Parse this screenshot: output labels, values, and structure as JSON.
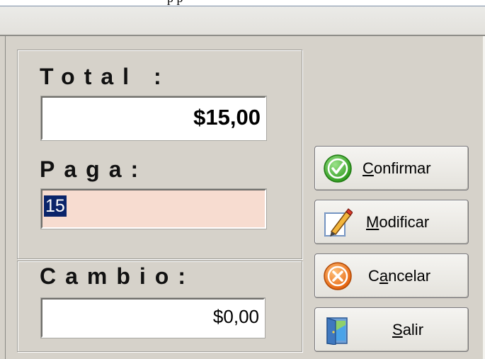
{
  "window": {
    "caption_fragment": "p p"
  },
  "payment": {
    "total_label": "Total :",
    "total_value": "$15,00",
    "paid_label": "Paga:",
    "paid_value": "15",
    "change_label": "Cambio:",
    "change_value": "$0,00"
  },
  "buttons": {
    "confirm": {
      "accel": "C",
      "rest": "onfirmar",
      "icon": "check-circle-icon"
    },
    "modify": {
      "accel": "M",
      "rest": "odificar",
      "icon": "pencil-document-icon"
    },
    "cancel": {
      "pre": "C",
      "accel": "a",
      "rest": "ncelar",
      "icon": "cancel-circle-icon"
    },
    "exit": {
      "accel": "S",
      "rest": "alir",
      "icon": "exit-door-icon"
    }
  },
  "colors": {
    "background": "#d6d2ca",
    "paid_field": "#f7dcd0",
    "selection": "#0a246a",
    "confirm_green": "#3fae2a",
    "cancel_orange": "#f07a1a"
  }
}
